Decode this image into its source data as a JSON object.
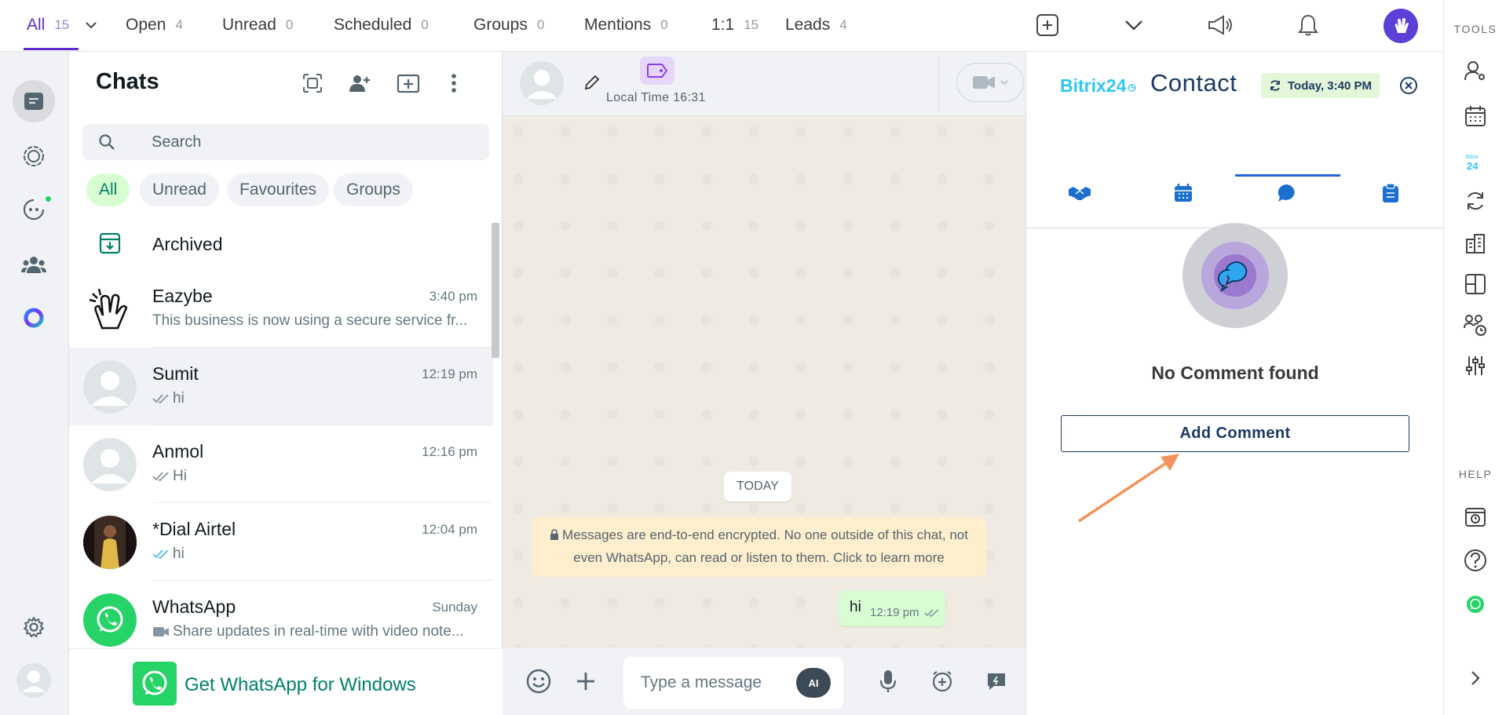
{
  "top_filters": [
    {
      "label": "All",
      "count": "15"
    },
    {
      "label": "Open",
      "count": "4"
    },
    {
      "label": "Unread",
      "count": "0"
    },
    {
      "label": "Scheduled",
      "count": "0"
    },
    {
      "label": "Groups",
      "count": "0"
    },
    {
      "label": "Mentions",
      "count": "0"
    },
    {
      "label": "1:1",
      "count": "15"
    },
    {
      "label": "Leads",
      "count": "4"
    }
  ],
  "chat_list": {
    "title": "Chats",
    "search_placeholder": "Search",
    "chips": [
      "All",
      "Unread",
      "Favourites",
      "Groups"
    ],
    "archived_label": "Archived",
    "chats": [
      {
        "name": "Eazybe",
        "time": "3:40 pm",
        "preview": "This business is now using a secure service fr..."
      },
      {
        "name": "Sumit",
        "time": "12:19 pm",
        "preview": "hi"
      },
      {
        "name": "Anmol",
        "time": "12:16 pm",
        "preview": "Hi"
      },
      {
        "name": "*Dial Airtel",
        "time": "12:04 pm",
        "preview": "hi"
      },
      {
        "name": "WhatsApp",
        "time": "Sunday",
        "preview": "Share updates in real-time with video note..."
      }
    ],
    "get_app_label": "Get WhatsApp for Windows"
  },
  "conversation": {
    "local_time": "Local Time 16:31",
    "date_badge": "TODAY",
    "encryption_notice": "Messages are end-to-end encrypted. No one outside of this chat, not even WhatsApp, can read or listen to them. Click to learn more",
    "messages": [
      {
        "text": "hi",
        "time": "12:19 pm"
      }
    ],
    "composer_placeholder": "Type a message",
    "ai_label": "AI"
  },
  "contact_panel": {
    "brand": "Bitrix24",
    "title": "Contact",
    "synced_label": "Today, 3:40 PM",
    "empty_text": "No Comment found",
    "add_button": "Add Comment"
  },
  "tools": {
    "tools_header": "TOOLS",
    "help_header": "HELP"
  },
  "colors": {
    "accent": "#5b2bd1",
    "whatsapp_green": "#25d366",
    "bitrix_navy": "#1b3a63",
    "bitrix_blue": "#2fc6f6"
  }
}
